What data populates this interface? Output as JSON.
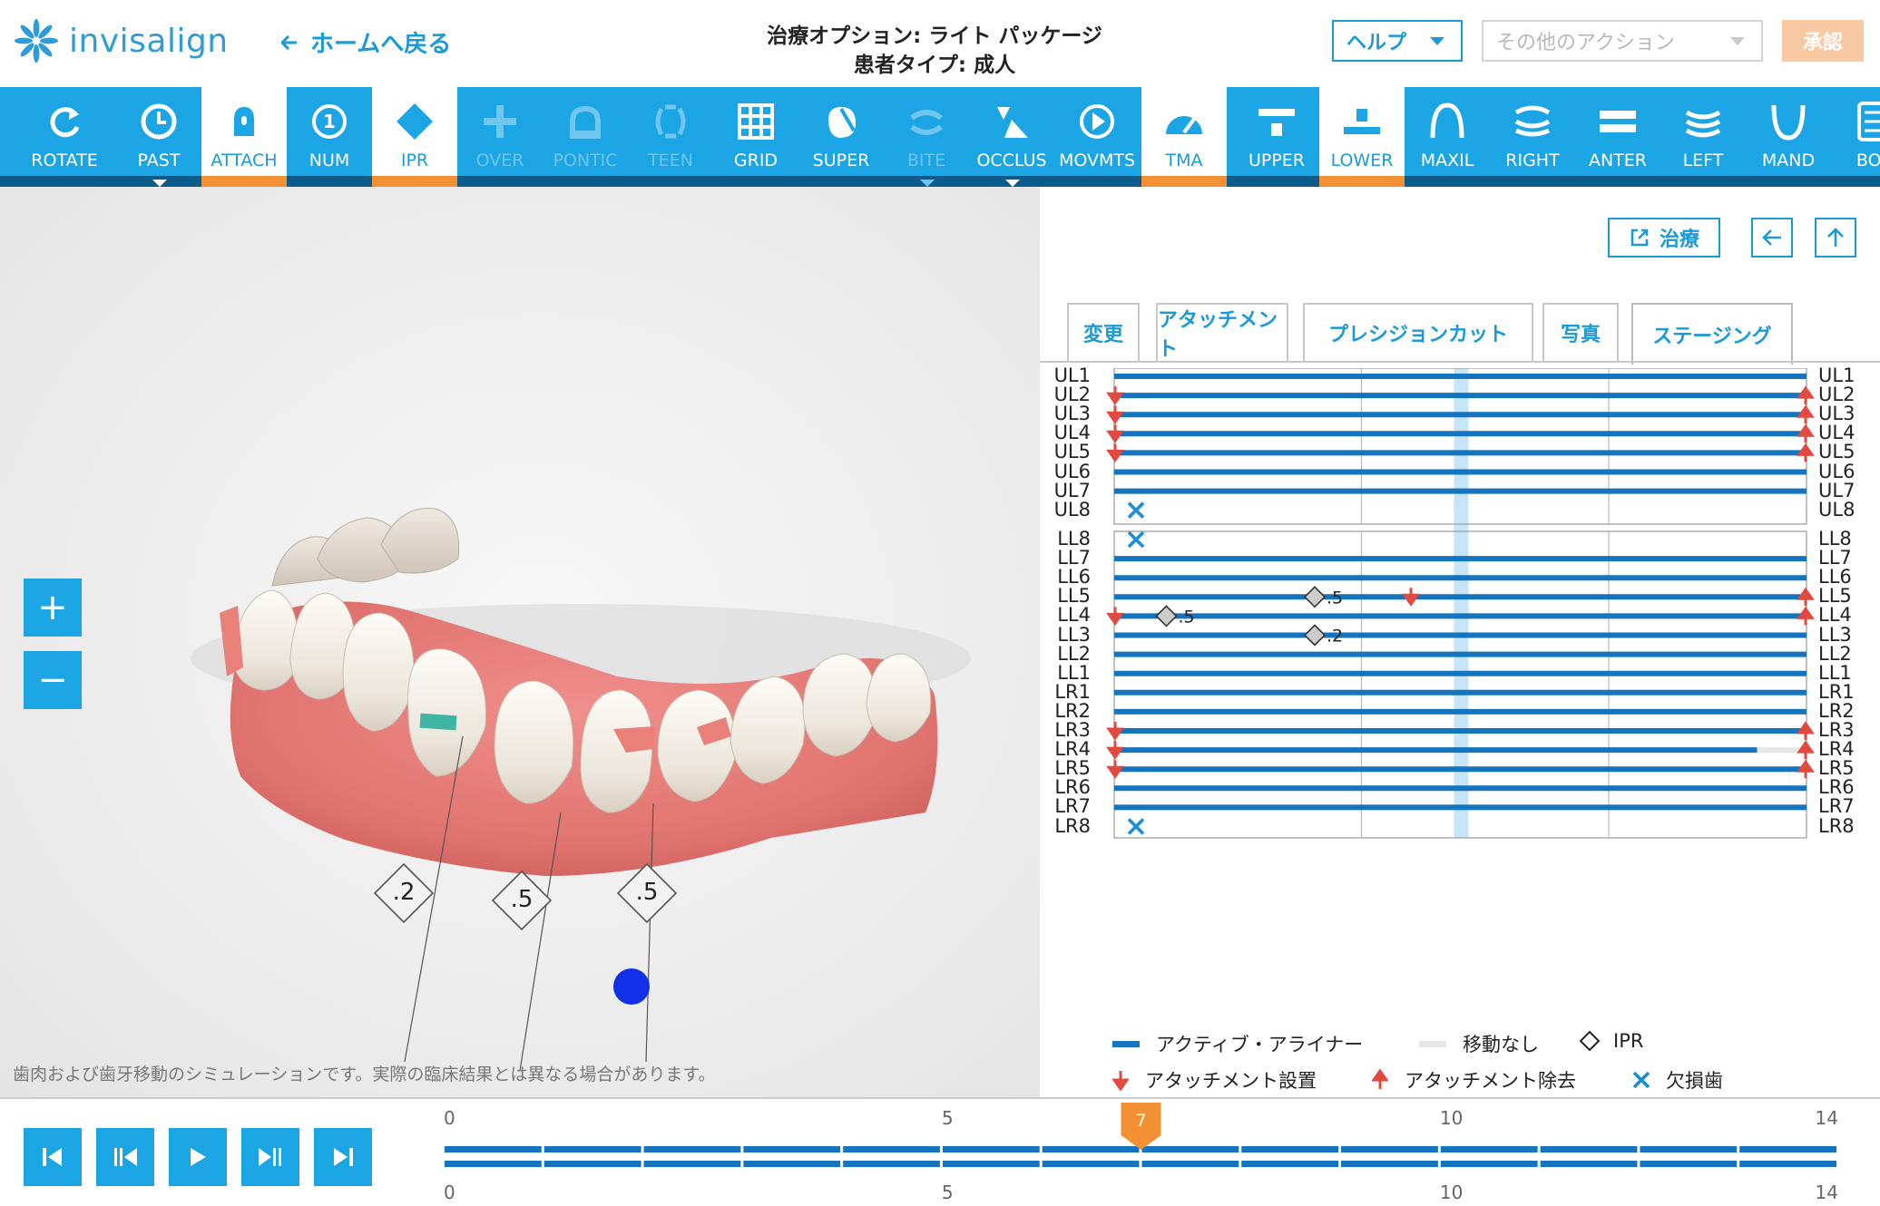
{
  "header": {
    "logo_text": "invisalign",
    "back_label": "ホームへ戻る",
    "treatment_option": "治療オプション: ライト パッケージ",
    "patient_type": "患者タイプ: 成人",
    "help_label": "ヘルプ",
    "actions_placeholder": "その他のアクション",
    "approve_label": "承認"
  },
  "toolbar": {
    "items": [
      {
        "label": "ROTATE",
        "icon": "rotate-icon",
        "state": "normal"
      },
      {
        "label": "PAST",
        "icon": "history-icon",
        "state": "normal",
        "submenu": true
      },
      {
        "label": "ATTACH",
        "icon": "attachment-icon",
        "state": "active"
      },
      {
        "label": "NUM",
        "icon": "number-icon",
        "state": "normal"
      },
      {
        "label": "IPR",
        "icon": "ipr-diamond-icon",
        "state": "active"
      },
      {
        "label": "OVER",
        "icon": "overlay-plus-icon",
        "state": "disabled"
      },
      {
        "label": "PONTIC",
        "icon": "pontic-icon",
        "state": "disabled"
      },
      {
        "label": "TEEN",
        "icon": "teen-icon",
        "state": "disabled"
      },
      {
        "label": "GRID",
        "icon": "grid-icon",
        "state": "normal"
      },
      {
        "label": "SUPER",
        "icon": "superimpose-icon",
        "state": "normal"
      },
      {
        "label": "BITE",
        "icon": "bite-icon",
        "state": "disabled",
        "submenu": true
      },
      {
        "label": "OCCLUS",
        "icon": "occlusion-icon",
        "state": "normal",
        "submenu": true
      },
      {
        "label": "MOVMTS",
        "icon": "movements-icon",
        "state": "normal"
      },
      {
        "label": "TMA",
        "icon": "gauge-icon",
        "state": "active"
      },
      {
        "label": "UPPER",
        "icon": "upper-jaw-icon",
        "state": "normal"
      },
      {
        "label": "LOWER",
        "icon": "lower-jaw-icon",
        "state": "active"
      },
      {
        "label": "MAXIL",
        "icon": "maxillary-icon",
        "state": "normal"
      },
      {
        "label": "RIGHT",
        "icon": "right-view-icon",
        "state": "normal"
      },
      {
        "label": "ANTER",
        "icon": "anterior-view-icon",
        "state": "normal"
      },
      {
        "label": "LEFT",
        "icon": "left-view-icon",
        "state": "normal"
      },
      {
        "label": "MAND",
        "icon": "mandibular-icon",
        "state": "normal"
      },
      {
        "label": "BOL",
        "icon": "bolton-icon",
        "state": "normal"
      }
    ]
  },
  "viewer": {
    "zoom_in": "+",
    "zoom_out": "−",
    "ipr_labels": [
      ".2",
      ".5",
      ".5"
    ],
    "disclaimer": "歯肉および歯牙移動のシミュレーションです。実際の臨床結果とは異なる場合があります。"
  },
  "panel": {
    "treatment_button": "治療",
    "tabs": [
      {
        "label": "変更",
        "active": false
      },
      {
        "label": "アタッチメント",
        "active": false
      },
      {
        "label": "プレシジョンカット",
        "active": false
      },
      {
        "label": "写真",
        "active": false
      },
      {
        "label": "ステージング",
        "active": true
      }
    ],
    "upper_teeth": [
      {
        "id": "UL1",
        "bar": [
          0,
          14
        ],
        "left": null,
        "right": null,
        "missing": false
      },
      {
        "id": "UL2",
        "bar": [
          0,
          14
        ],
        "left": "place",
        "right": "remove",
        "missing": false
      },
      {
        "id": "UL3",
        "bar": [
          0,
          14
        ],
        "left": "place",
        "right": "remove",
        "missing": false
      },
      {
        "id": "UL4",
        "bar": [
          0,
          14
        ],
        "left": "place",
        "right": "remove",
        "missing": false
      },
      {
        "id": "UL5",
        "bar": [
          0,
          14
        ],
        "left": "place",
        "right": "remove",
        "missing": false
      },
      {
        "id": "UL6",
        "bar": [
          0,
          14
        ],
        "left": null,
        "right": null,
        "missing": false
      },
      {
        "id": "UL7",
        "bar": [
          0,
          14
        ],
        "left": null,
        "right": null,
        "missing": false
      },
      {
        "id": "UL8",
        "bar": null,
        "left": null,
        "right": null,
        "missing": true
      }
    ],
    "lower_teeth": [
      {
        "id": "LL8",
        "bar": null,
        "missing": true
      },
      {
        "id": "LL7",
        "bar": [
          0,
          14
        ]
      },
      {
        "id": "LL6",
        "bar": [
          0,
          14
        ]
      },
      {
        "id": "LL5",
        "bar": [
          0,
          14
        ],
        "mid_place": 6,
        "right": "remove",
        "ipr": {
          "stage": 4,
          "value": ".5"
        }
      },
      {
        "id": "LL4",
        "bar": [
          0,
          14
        ],
        "left": "place",
        "right": "remove",
        "ipr": {
          "stage": 1,
          "value": ".5"
        }
      },
      {
        "id": "LL3",
        "bar": [
          0,
          14
        ],
        "ipr": {
          "stage": 4,
          "value": ".2"
        }
      },
      {
        "id": "LL2",
        "bar": [
          0,
          14
        ]
      },
      {
        "id": "LL1",
        "bar": [
          0,
          14
        ]
      },
      {
        "id": "LR1",
        "bar": [
          0,
          14
        ]
      },
      {
        "id": "LR2",
        "bar": [
          0,
          14
        ]
      },
      {
        "id": "LR3",
        "bar": [
          0,
          14
        ],
        "left": "place",
        "right": "remove"
      },
      {
        "id": "LR4",
        "bar": [
          0,
          13
        ],
        "idle": [
          13,
          14
        ],
        "left": "place",
        "right": "remove"
      },
      {
        "id": "LR5",
        "bar": [
          0,
          14
        ],
        "left": "place",
        "right": "remove"
      },
      {
        "id": "LR6",
        "bar": [
          0,
          14
        ]
      },
      {
        "id": "LR7",
        "bar": [
          0,
          14
        ]
      },
      {
        "id": "LR8",
        "bar": null,
        "missing": true
      }
    ],
    "current_stage": 7,
    "total_stages": 14,
    "legend": {
      "active": "アクティブ・アライナー",
      "no_move": "移動なし",
      "ipr": "IPR",
      "attach_place": "アタッチメント設置",
      "attach_remove": "アタッチメント除去",
      "missing": "欠損歯"
    }
  },
  "timeline": {
    "current": "7",
    "ticks": [
      "0",
      "5",
      "10",
      "14"
    ],
    "stages": 14
  },
  "colors": {
    "brand_blue": "#1ba5e4",
    "bar_blue": "#1474bd",
    "accent_orange": "#f39033",
    "attach_red": "#e2493f",
    "highlight": "#c6e6f7"
  }
}
